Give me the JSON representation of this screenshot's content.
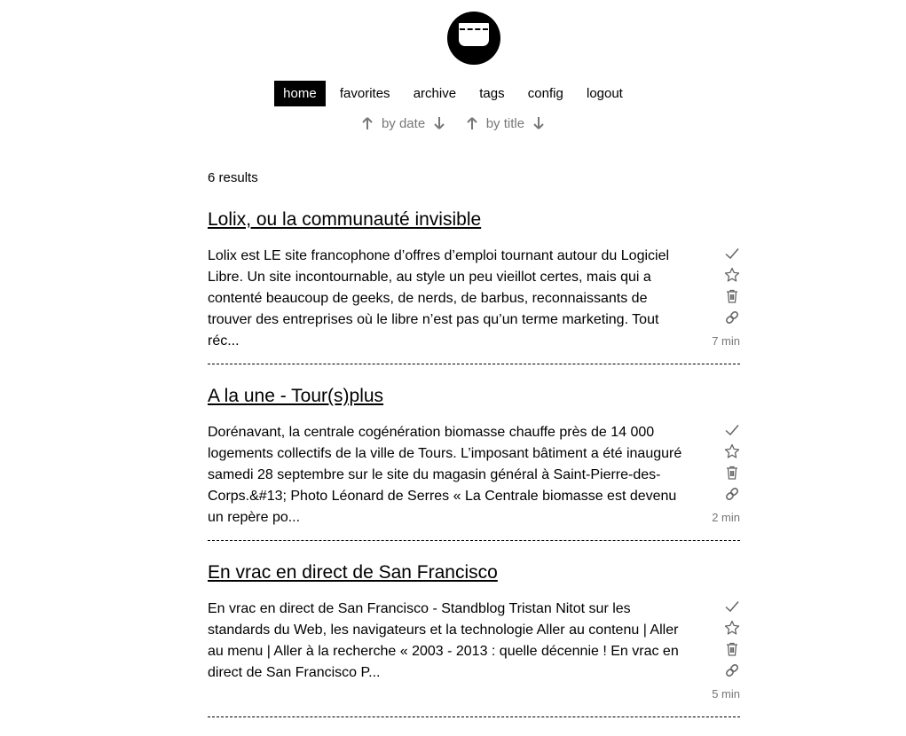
{
  "nav": {
    "items": [
      {
        "label": "home",
        "active": true
      },
      {
        "label": "favorites",
        "active": false
      },
      {
        "label": "archive",
        "active": false
      },
      {
        "label": "tags",
        "active": false
      },
      {
        "label": "config",
        "active": false
      },
      {
        "label": "logout",
        "active": false
      }
    ]
  },
  "sort": {
    "by_date": "by date",
    "by_title": "by title"
  },
  "results": {
    "count_text": "6 results"
  },
  "icons": {
    "logo": "pocket-logo-icon",
    "sort_up": "arrow-up-icon",
    "sort_down": "arrow-down-icon",
    "archive": "check-icon",
    "favorite": "star-icon",
    "delete": "trash-icon",
    "original": "link-icon"
  },
  "entries": [
    {
      "title": "Lolix, ou la communauté invisible",
      "excerpt": "Lolix est LE site francophone d’offres d’emploi tournant autour du Logiciel Libre. Un site incontournable, au style un peu vieillot certes, mais qui a contenté beaucoup de geeks, de nerds, de barbus, reconnaissants de trouver des entreprises où le libre n’est pas qu’un terme marketing. Tout réc...",
      "reading_time": "7 min"
    },
    {
      "title": "A la une - Tour(s)plus",
      "excerpt": "Dorénavant, la centrale cogénération biomasse chauffe près de 14 000 logements collectifs de la ville de Tours. L’imposant bâtiment a été inauguré samedi 28 septembre sur le site du magasin général à Saint-Pierre-des-Corps.&#13; Photo Léonard de Serres « La Centrale biomasse est devenu un repère po...",
      "reading_time": "2 min"
    },
    {
      "title": "En vrac en direct de San Francisco",
      "excerpt": "En vrac en direct de San Francisco - Standblog Tristan Nitot sur les standards du Web, les navigateurs et la technologie Aller au contenu | Aller au menu | Aller à la recherche « 2003 - 2013 : quelle décennie ! En vrac en direct de San Francisco P...",
      "reading_time": "5 min"
    }
  ]
}
